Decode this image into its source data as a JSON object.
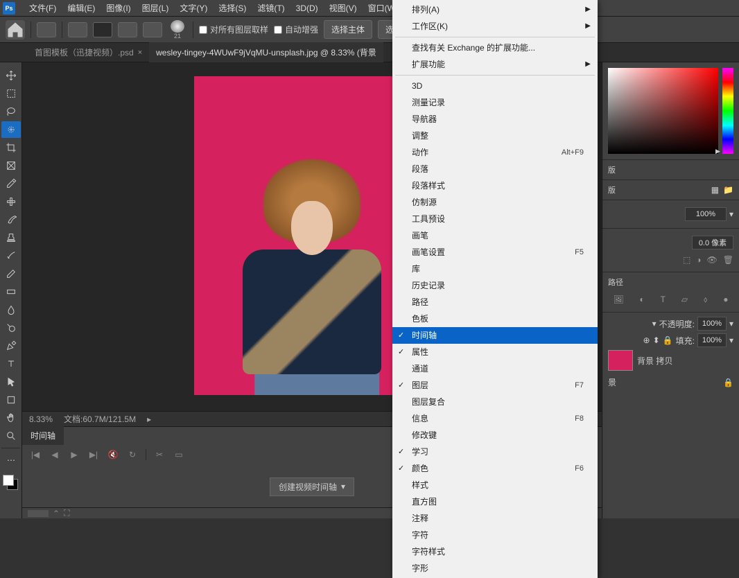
{
  "menubar": {
    "items": [
      "文件(F)",
      "编辑(E)",
      "图像(I)",
      "图层(L)",
      "文字(Y)",
      "选择(S)",
      "滤镜(T)",
      "3D(D)",
      "视图(V)",
      "窗口(W)"
    ]
  },
  "optionsbar": {
    "brush_size": "21",
    "sample_all": "对所有图层取样",
    "auto_enhance": "自动增强",
    "select_subject": "选择主体",
    "select_partial": "选"
  },
  "tabs": {
    "tab1": "首图模板（迅捷视频）.psd",
    "tab2": "wesley-tingey-4WUwF9jVqMU-unsplash.jpg @ 8.33% (背景"
  },
  "status": {
    "zoom": "8.33%",
    "doc": "文档:60.7M/121.5M"
  },
  "timeline": {
    "tab": "时间轴",
    "create": "创建视频时间轴"
  },
  "dropdown": {
    "arrange": "排列(A)",
    "workspace": "工作区(K)",
    "find_ext": "查找有关 Exchange 的扩展功能...",
    "extensions": "扩展功能",
    "threeD": "3D",
    "measure": "测量记录",
    "navigator": "导航器",
    "adjustments": "调整",
    "actions": "动作",
    "actions_sc": "Alt+F9",
    "paragraph": "段落",
    "para_styles": "段落样式",
    "clone_src": "仿制源",
    "tool_presets": "工具预设",
    "brush": "画笔",
    "brush_settings": "画笔设置",
    "brush_sc": "F5",
    "library": "库",
    "history": "历史记录",
    "paths": "路径",
    "swatches": "色板",
    "timeline_i": "时间轴",
    "properties": "属性",
    "channels": "通道",
    "layers": "图层",
    "layers_sc": "F7",
    "layer_comps": "图层复合",
    "info": "信息",
    "info_sc": "F8",
    "modifier": "修改键",
    "learn": "学习",
    "color": "颜色",
    "color_sc": "F6",
    "styles": "样式",
    "histogram": "直方图",
    "notes": "注释",
    "character": "字符",
    "char_styles": "字符样式",
    "glyphs": "字形"
  },
  "panels": {
    "swatches_tab": "版",
    "presets_tab": "版",
    "pct100": "100%",
    "feather": "0.0 像素",
    "paths_tab": "路径",
    "opacity_label": "不透明度:",
    "opacity_val": "100%",
    "fill_label": "填充:",
    "fill_val": "100%",
    "layer_copy": "背景 拷贝",
    "bg_layer": "景"
  }
}
